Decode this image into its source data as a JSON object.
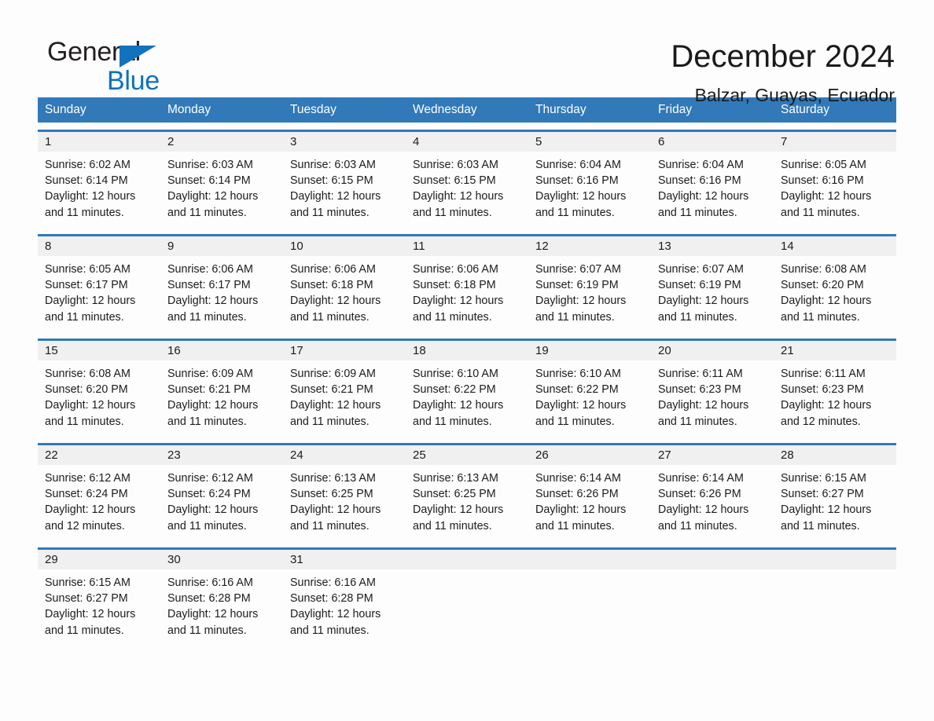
{
  "logo": {
    "word_one": "General",
    "word_two": "Blue",
    "triangle_color": "#1273bc",
    "word_two_color": "#0f72bb"
  },
  "header": {
    "title": "December 2024",
    "location": "Balzar, Guayas, Ecuador"
  },
  "theme": {
    "header_bar_color": "#3179b9",
    "row_rule_color": "#3179b9",
    "daynum_band_color": "#f0f0f0",
    "page_background": "#fdfdfd",
    "text_color": "#1c1c1c"
  },
  "weekdays": [
    "Sunday",
    "Monday",
    "Tuesday",
    "Wednesday",
    "Thursday",
    "Friday",
    "Saturday"
  ],
  "weeks": [
    [
      {
        "day": "1",
        "sunrise": "Sunrise: 6:02 AM",
        "sunset": "Sunset: 6:14 PM",
        "daylight_line1": "Daylight: 12 hours",
        "daylight_line2": "and 11 minutes."
      },
      {
        "day": "2",
        "sunrise": "Sunrise: 6:03 AM",
        "sunset": "Sunset: 6:14 PM",
        "daylight_line1": "Daylight: 12 hours",
        "daylight_line2": "and 11 minutes."
      },
      {
        "day": "3",
        "sunrise": "Sunrise: 6:03 AM",
        "sunset": "Sunset: 6:15 PM",
        "daylight_line1": "Daylight: 12 hours",
        "daylight_line2": "and 11 minutes."
      },
      {
        "day": "4",
        "sunrise": "Sunrise: 6:03 AM",
        "sunset": "Sunset: 6:15 PM",
        "daylight_line1": "Daylight: 12 hours",
        "daylight_line2": "and 11 minutes."
      },
      {
        "day": "5",
        "sunrise": "Sunrise: 6:04 AM",
        "sunset": "Sunset: 6:16 PM",
        "daylight_line1": "Daylight: 12 hours",
        "daylight_line2": "and 11 minutes."
      },
      {
        "day": "6",
        "sunrise": "Sunrise: 6:04 AM",
        "sunset": "Sunset: 6:16 PM",
        "daylight_line1": "Daylight: 12 hours",
        "daylight_line2": "and 11 minutes."
      },
      {
        "day": "7",
        "sunrise": "Sunrise: 6:05 AM",
        "sunset": "Sunset: 6:16 PM",
        "daylight_line1": "Daylight: 12 hours",
        "daylight_line2": "and 11 minutes."
      }
    ],
    [
      {
        "day": "8",
        "sunrise": "Sunrise: 6:05 AM",
        "sunset": "Sunset: 6:17 PM",
        "daylight_line1": "Daylight: 12 hours",
        "daylight_line2": "and 11 minutes."
      },
      {
        "day": "9",
        "sunrise": "Sunrise: 6:06 AM",
        "sunset": "Sunset: 6:17 PM",
        "daylight_line1": "Daylight: 12 hours",
        "daylight_line2": "and 11 minutes."
      },
      {
        "day": "10",
        "sunrise": "Sunrise: 6:06 AM",
        "sunset": "Sunset: 6:18 PM",
        "daylight_line1": "Daylight: 12 hours",
        "daylight_line2": "and 11 minutes."
      },
      {
        "day": "11",
        "sunrise": "Sunrise: 6:06 AM",
        "sunset": "Sunset: 6:18 PM",
        "daylight_line1": "Daylight: 12 hours",
        "daylight_line2": "and 11 minutes."
      },
      {
        "day": "12",
        "sunrise": "Sunrise: 6:07 AM",
        "sunset": "Sunset: 6:19 PM",
        "daylight_line1": "Daylight: 12 hours",
        "daylight_line2": "and 11 minutes."
      },
      {
        "day": "13",
        "sunrise": "Sunrise: 6:07 AM",
        "sunset": "Sunset: 6:19 PM",
        "daylight_line1": "Daylight: 12 hours",
        "daylight_line2": "and 11 minutes."
      },
      {
        "day": "14",
        "sunrise": "Sunrise: 6:08 AM",
        "sunset": "Sunset: 6:20 PM",
        "daylight_line1": "Daylight: 12 hours",
        "daylight_line2": "and 11 minutes."
      }
    ],
    [
      {
        "day": "15",
        "sunrise": "Sunrise: 6:08 AM",
        "sunset": "Sunset: 6:20 PM",
        "daylight_line1": "Daylight: 12 hours",
        "daylight_line2": "and 11 minutes."
      },
      {
        "day": "16",
        "sunrise": "Sunrise: 6:09 AM",
        "sunset": "Sunset: 6:21 PM",
        "daylight_line1": "Daylight: 12 hours",
        "daylight_line2": "and 11 minutes."
      },
      {
        "day": "17",
        "sunrise": "Sunrise: 6:09 AM",
        "sunset": "Sunset: 6:21 PM",
        "daylight_line1": "Daylight: 12 hours",
        "daylight_line2": "and 11 minutes."
      },
      {
        "day": "18",
        "sunrise": "Sunrise: 6:10 AM",
        "sunset": "Sunset: 6:22 PM",
        "daylight_line1": "Daylight: 12 hours",
        "daylight_line2": "and 11 minutes."
      },
      {
        "day": "19",
        "sunrise": "Sunrise: 6:10 AM",
        "sunset": "Sunset: 6:22 PM",
        "daylight_line1": "Daylight: 12 hours",
        "daylight_line2": "and 11 minutes."
      },
      {
        "day": "20",
        "sunrise": "Sunrise: 6:11 AM",
        "sunset": "Sunset: 6:23 PM",
        "daylight_line1": "Daylight: 12 hours",
        "daylight_line2": "and 11 minutes."
      },
      {
        "day": "21",
        "sunrise": "Sunrise: 6:11 AM",
        "sunset": "Sunset: 6:23 PM",
        "daylight_line1": "Daylight: 12 hours",
        "daylight_line2": "and 12 minutes."
      }
    ],
    [
      {
        "day": "22",
        "sunrise": "Sunrise: 6:12 AM",
        "sunset": "Sunset: 6:24 PM",
        "daylight_line1": "Daylight: 12 hours",
        "daylight_line2": "and 12 minutes."
      },
      {
        "day": "23",
        "sunrise": "Sunrise: 6:12 AM",
        "sunset": "Sunset: 6:24 PM",
        "daylight_line1": "Daylight: 12 hours",
        "daylight_line2": "and 11 minutes."
      },
      {
        "day": "24",
        "sunrise": "Sunrise: 6:13 AM",
        "sunset": "Sunset: 6:25 PM",
        "daylight_line1": "Daylight: 12 hours",
        "daylight_line2": "and 11 minutes."
      },
      {
        "day": "25",
        "sunrise": "Sunrise: 6:13 AM",
        "sunset": "Sunset: 6:25 PM",
        "daylight_line1": "Daylight: 12 hours",
        "daylight_line2": "and 11 minutes."
      },
      {
        "day": "26",
        "sunrise": "Sunrise: 6:14 AM",
        "sunset": "Sunset: 6:26 PM",
        "daylight_line1": "Daylight: 12 hours",
        "daylight_line2": "and 11 minutes."
      },
      {
        "day": "27",
        "sunrise": "Sunrise: 6:14 AM",
        "sunset": "Sunset: 6:26 PM",
        "daylight_line1": "Daylight: 12 hours",
        "daylight_line2": "and 11 minutes."
      },
      {
        "day": "28",
        "sunrise": "Sunrise: 6:15 AM",
        "sunset": "Sunset: 6:27 PM",
        "daylight_line1": "Daylight: 12 hours",
        "daylight_line2": "and 11 minutes."
      }
    ],
    [
      {
        "day": "29",
        "sunrise": "Sunrise: 6:15 AM",
        "sunset": "Sunset: 6:27 PM",
        "daylight_line1": "Daylight: 12 hours",
        "daylight_line2": "and 11 minutes."
      },
      {
        "day": "30",
        "sunrise": "Sunrise: 6:16 AM",
        "sunset": "Sunset: 6:28 PM",
        "daylight_line1": "Daylight: 12 hours",
        "daylight_line2": "and 11 minutes."
      },
      {
        "day": "31",
        "sunrise": "Sunrise: 6:16 AM",
        "sunset": "Sunset: 6:28 PM",
        "daylight_line1": "Daylight: 12 hours",
        "daylight_line2": "and 11 minutes."
      },
      {
        "day": "",
        "sunrise": "",
        "sunset": "",
        "daylight_line1": "",
        "daylight_line2": ""
      },
      {
        "day": "",
        "sunrise": "",
        "sunset": "",
        "daylight_line1": "",
        "daylight_line2": ""
      },
      {
        "day": "",
        "sunrise": "",
        "sunset": "",
        "daylight_line1": "",
        "daylight_line2": ""
      },
      {
        "day": "",
        "sunrise": "",
        "sunset": "",
        "daylight_line1": "",
        "daylight_line2": ""
      }
    ]
  ]
}
